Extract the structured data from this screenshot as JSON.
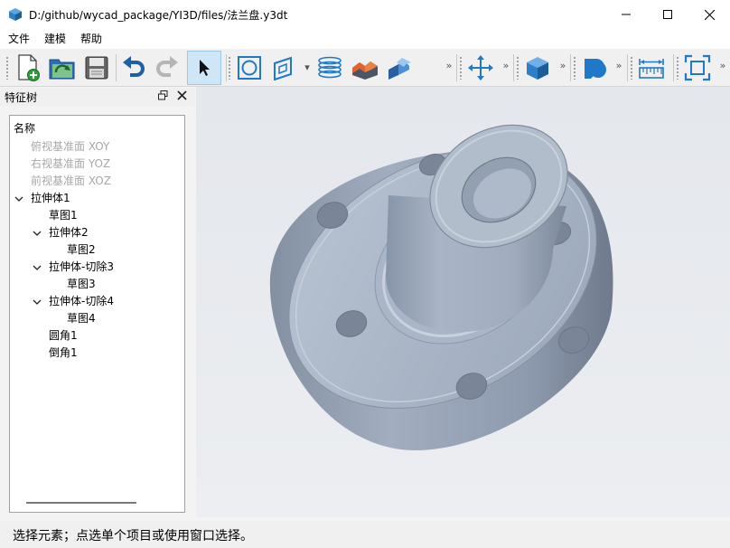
{
  "window": {
    "title": "D:/github/wycad_package/YI3D/files/法兰盘.y3dt"
  },
  "menu": {
    "items": [
      "文件",
      "建模",
      "帮助"
    ]
  },
  "toolbar": {
    "buttons": [
      {
        "name": "new-document",
        "icon": "new-document-icon"
      },
      {
        "name": "open-file",
        "icon": "open-file-icon"
      },
      {
        "name": "save",
        "icon": "floppy-disk-icon"
      },
      {
        "name": "undo",
        "icon": "undo-icon"
      },
      {
        "name": "redo",
        "icon": "redo-icon"
      },
      {
        "name": "select",
        "icon": "cursor-arrow-icon",
        "active": true
      },
      {
        "name": "sketch-circle",
        "icon": "circle-in-square-icon"
      },
      {
        "name": "sketch-plane",
        "icon": "plane-icon"
      },
      {
        "name": "helix",
        "icon": "helix-icon"
      },
      {
        "name": "extrude-cut",
        "icon": "cut-block-icon"
      },
      {
        "name": "fillet",
        "icon": "fillet-icon"
      },
      {
        "name": "move",
        "icon": "move-arrows-icon"
      },
      {
        "name": "view-cube",
        "icon": "cube-icon"
      },
      {
        "name": "display-mode",
        "icon": "shape-icon"
      },
      {
        "name": "measure",
        "icon": "ruler-icon"
      },
      {
        "name": "fit-view",
        "icon": "fit-view-icon"
      }
    ],
    "overflow_label": "»"
  },
  "feature_panel": {
    "title": "特征树",
    "column_header": "名称",
    "rows": [
      {
        "label": "俯视基准面 XOY",
        "level": 1,
        "dim": true
      },
      {
        "label": "右视基准面 YOZ",
        "level": 1,
        "dim": true
      },
      {
        "label": "前视基准面 XOZ",
        "level": 1,
        "dim": true
      },
      {
        "label": "拉伸体1",
        "level": 1,
        "expanded": true
      },
      {
        "label": "草图1",
        "level": 2
      },
      {
        "label": "拉伸体2",
        "level": 2,
        "expanded": true
      },
      {
        "label": "草图2",
        "level": 3
      },
      {
        "label": "拉伸体-切除3",
        "level": 2,
        "expanded": true
      },
      {
        "label": "草图3",
        "level": 3
      },
      {
        "label": "拉伸体-切除4",
        "level": 2,
        "expanded": true
      },
      {
        "label": "草图4",
        "level": 3
      },
      {
        "label": "圆角1",
        "level": 2
      },
      {
        "label": "倒角1",
        "level": 2
      }
    ]
  },
  "viewport": {
    "model": "flange-disc",
    "colors": {
      "face": "#a7b4c6",
      "face_dark": "#7d8a9c",
      "background": "#e8eaee"
    }
  },
  "status": {
    "text": "选择元素；点选单个项目或使用窗口选择。"
  }
}
